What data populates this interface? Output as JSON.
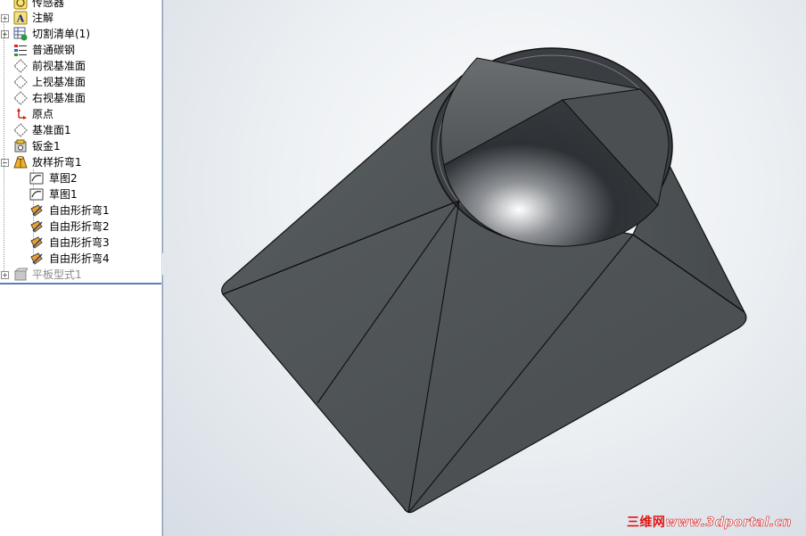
{
  "feature_tree": {
    "items": [
      {
        "label": "传感器",
        "icon": "sensor-icon",
        "expandable": false
      },
      {
        "label": "注解",
        "icon": "annotation-icon",
        "expandable": true
      },
      {
        "label": "切割清单(1)",
        "icon": "cut-list-icon",
        "expandable": true
      },
      {
        "label": "普通碳钢",
        "icon": "material-icon",
        "expandable": false
      },
      {
        "label": "前视基准面",
        "icon": "plane-icon",
        "expandable": false
      },
      {
        "label": "上视基准面",
        "icon": "plane-icon",
        "expandable": false
      },
      {
        "label": "右视基准面",
        "icon": "plane-icon",
        "expandable": false
      },
      {
        "label": "原点",
        "icon": "origin-icon",
        "expandable": false
      },
      {
        "label": "基准面1",
        "icon": "plane-icon",
        "expandable": false
      },
      {
        "label": "钣金1",
        "icon": "sheet-metal-icon",
        "expandable": false
      },
      {
        "label": "放样折弯1",
        "icon": "lofted-bend-icon",
        "expandable": true,
        "expanded": true,
        "children": [
          {
            "label": "草图2",
            "icon": "sketch-icon"
          },
          {
            "label": "草图1",
            "icon": "sketch-icon"
          },
          {
            "label": "自由形折弯1",
            "icon": "freeform-bend-icon"
          },
          {
            "label": "自由形折弯2",
            "icon": "freeform-bend-icon"
          },
          {
            "label": "自由形折弯3",
            "icon": "freeform-bend-icon"
          },
          {
            "label": "自由形折弯4",
            "icon": "freeform-bend-icon"
          }
        ]
      },
      {
        "label": "平板型式1",
        "icon": "flat-pattern-icon",
        "expandable": true,
        "suppressed": true
      }
    ]
  },
  "viewport": {
    "model_color": "#4f5457",
    "background": "#e9edf1"
  },
  "watermark": {
    "cn": "三维网",
    "url": "www.3dportal.cn"
  },
  "colors": {
    "accent": "#5b7fb5",
    "watermark": "#d60f0f"
  }
}
